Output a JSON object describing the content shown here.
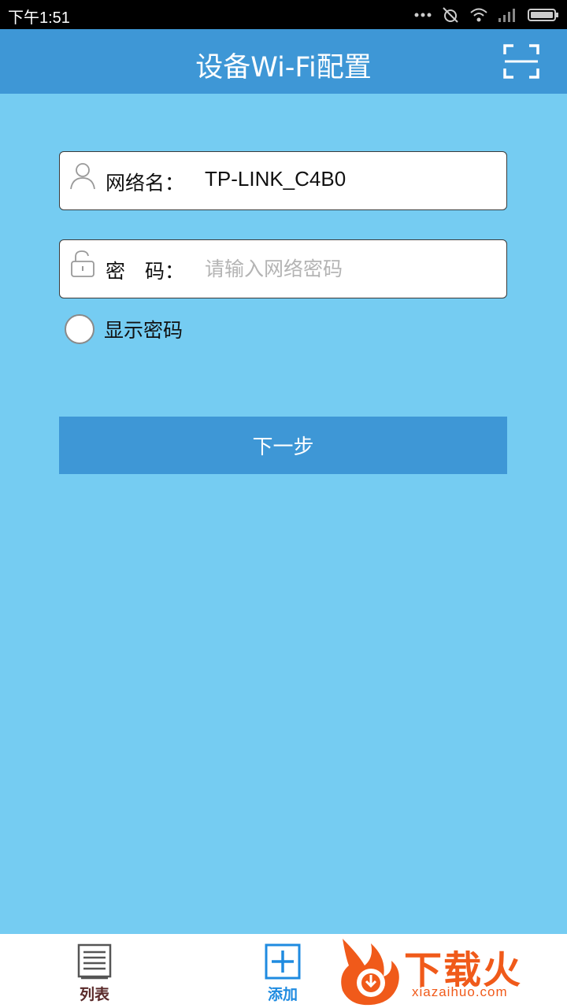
{
  "status_bar": {
    "time": "下午1:51"
  },
  "app_bar": {
    "title": "设备Wi-Fi配置",
    "scan_icon": "scan-frame-icon"
  },
  "form": {
    "ssid_label": "网络名：",
    "ssid_value": "TP-LINK_C4B0",
    "password_label": "密　码：",
    "password_value": "",
    "password_placeholder": "请输入网络密码",
    "show_password_label": "显示密码",
    "show_password_checked": false,
    "next_button": "下一步"
  },
  "bottom_nav": {
    "items": [
      {
        "label": "列表",
        "icon": "list-icon"
      },
      {
        "label": "添加",
        "icon": "add-icon"
      }
    ]
  },
  "watermark": {
    "text": "下载火",
    "domain": "xiazaihuo.com"
  },
  "colors": {
    "background": "#75CCF2",
    "app_bar": "#3E97D6",
    "watermark": "#F05A1A"
  }
}
